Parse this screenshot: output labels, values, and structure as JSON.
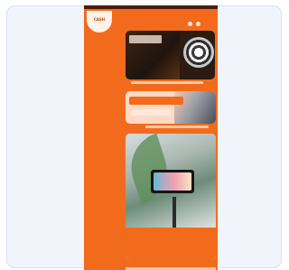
{
  "app": {
    "logo_text": "CASH"
  },
  "tiles": [
    {
      "text": ""
    },
    {
      "band_text": ""
    },
    {
      "text": ""
    }
  ],
  "colors": {
    "page_bg": "#ffffff",
    "card_bg": "#f1f5fb",
    "accent": "#f26b1d"
  }
}
